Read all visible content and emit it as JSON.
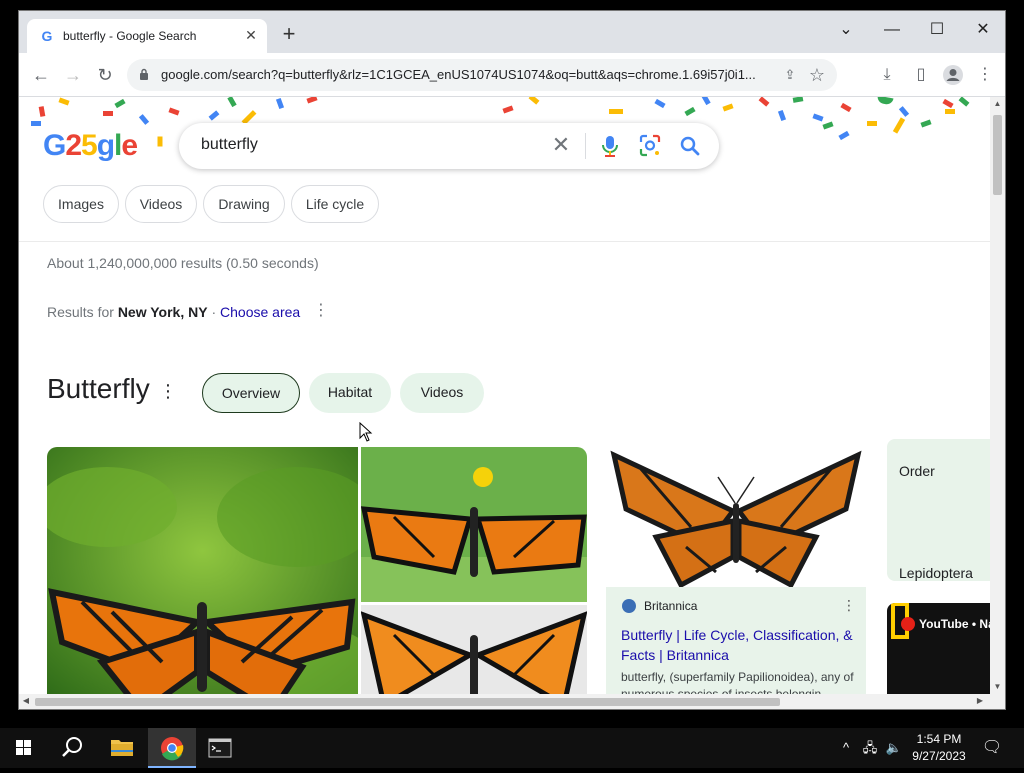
{
  "browser": {
    "tab_title": "butterfly - Google Search",
    "tab_favicon": "G",
    "tab_close": "✕",
    "new_tab": "+",
    "window_controls": {
      "dropdown": "⌄",
      "minimize": "—",
      "maximize": "☐",
      "close": "✕"
    },
    "url": "google.com/search?q=butterfly&rlz=1C1GCEA_enUS1074US1074&oq=butt&aqs=chrome.1.69i57j0i1...",
    "nav": {
      "back": "←",
      "forward": "→",
      "reload": "↻"
    },
    "toolbar_icons": {
      "share": "⇪",
      "star": "☆",
      "download": "⤓",
      "sidepanel": "▯",
      "profile": "●",
      "menu": "⋮"
    }
  },
  "search": {
    "logo": "G25gle",
    "query": "butterfly",
    "clear": "✕",
    "chips": [
      "Images",
      "Videos",
      "Drawing",
      "Life cycle"
    ],
    "stats": "About 1,240,000,000 results (0.50 seconds)",
    "location_prefix": "Results for ",
    "location_place": "New York, NY",
    "location_sep": " · ",
    "location_choose": "Choose area",
    "location_menu": "⋮"
  },
  "knowledge_panel": {
    "title": "Butterfly",
    "menu": "⋮",
    "tabs": [
      {
        "label": "Overview",
        "active": true
      },
      {
        "label": "Habitat",
        "active": false
      },
      {
        "label": "Videos",
        "active": false
      }
    ],
    "source_card": {
      "source": "Britannica",
      "menu": "⋮",
      "headline": "Butterfly | Life Cycle, Classification, & Facts | Britannica",
      "snippet": "butterfly, (superfamily Papilionoidea), any of numerous species of insects belongin..."
    },
    "order_card": {
      "label": "Order",
      "value": "Lepidoptera"
    },
    "video_card": {
      "label": "YouTube • Na"
    }
  },
  "taskbar": {
    "time": "1:54 PM",
    "date": "9/27/2023",
    "tray": {
      "chevron": "^",
      "network": "🖧",
      "volume": "🔈"
    },
    "notification": "🗨"
  },
  "colors": {
    "google_blue": "#4285f4",
    "google_red": "#ea4335",
    "google_yellow": "#fbbc05",
    "google_green": "#34a853",
    "link": "#1a0dab",
    "chip_green": "#e6f4ea"
  }
}
